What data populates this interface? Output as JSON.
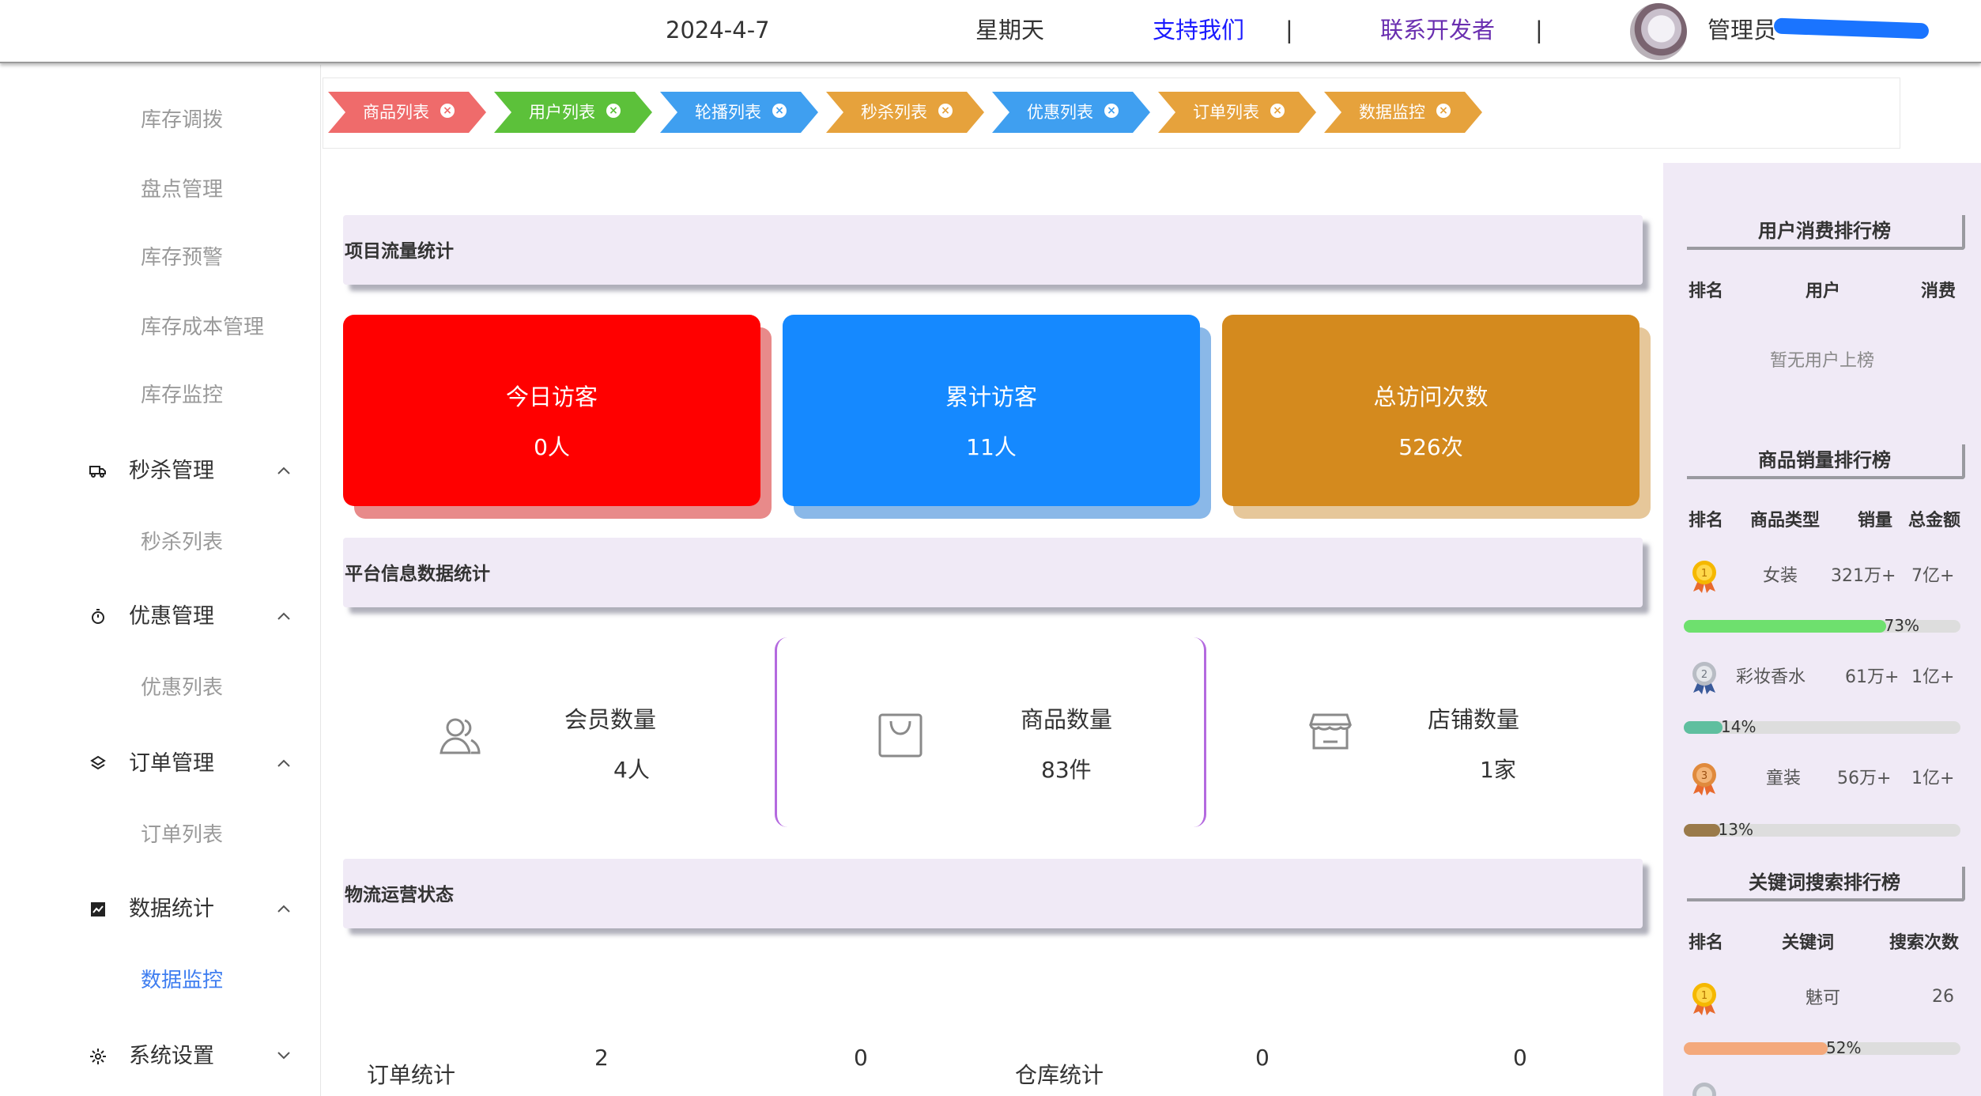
{
  "header": {
    "date": "2024-4-7",
    "weekday": "星期天",
    "support_link": "支持我们",
    "separator": "|",
    "contact_link": "联系开发者",
    "admin_label": "管理员"
  },
  "sidebar": {
    "top_items": [
      {
        "label": "库存调拨"
      },
      {
        "label": "盘点管理"
      },
      {
        "label": "库存预警"
      },
      {
        "label": "库存成本管理"
      },
      {
        "label": "库存监控"
      }
    ],
    "groups": [
      {
        "label": "秒杀管理",
        "icon": "truck-icon",
        "expanded": true,
        "children": [
          {
            "label": "秒杀列表"
          }
        ]
      },
      {
        "label": "优惠管理",
        "icon": "stopwatch-icon",
        "expanded": true,
        "children": [
          {
            "label": "优惠列表"
          }
        ]
      },
      {
        "label": "订单管理",
        "icon": "layers-icon",
        "expanded": true,
        "children": [
          {
            "label": "订单列表"
          }
        ]
      },
      {
        "label": "数据统计",
        "icon": "chart-icon",
        "expanded": true,
        "children": [
          {
            "label": "数据监控",
            "active": true
          }
        ]
      },
      {
        "label": "系统设置",
        "icon": "gear-icon",
        "expanded": false,
        "children": []
      }
    ]
  },
  "tabs": [
    {
      "label": "商品列表",
      "color": "#ef6b6b"
    },
    {
      "label": "用户列表",
      "color": "#5cc13a"
    },
    {
      "label": "轮播列表",
      "color": "#3f9ff0"
    },
    {
      "label": "秒杀列表",
      "color": "#e6a23c"
    },
    {
      "label": "优惠列表",
      "color": "#3f9ff0"
    },
    {
      "label": "订单列表",
      "color": "#e6a23c"
    },
    {
      "label": "数据监控",
      "color": "#e6a23c"
    }
  ],
  "sections": {
    "traffic": "项目流量统计",
    "platform": "平台信息数据统计",
    "logistics": "物流运营状态"
  },
  "traffic_cards": [
    {
      "label": "今日访客",
      "value": "0人",
      "color": "#ff0000",
      "shadow": "#e88a8a"
    },
    {
      "label": "累计访客",
      "value": "11人",
      "color": "#1589ff",
      "shadow": "#8ab8e8"
    },
    {
      "label": "总访问次数",
      "value": "526次",
      "color": "#d48a1e",
      "shadow": "#e6c79a"
    }
  ],
  "platform_stats": [
    {
      "label": "会员数量",
      "value": "4人",
      "icon": "users-icon"
    },
    {
      "label": "商品数量",
      "value": "83件",
      "icon": "shopping-bag-icon"
    },
    {
      "label": "店铺数量",
      "value": "1家",
      "icon": "store-icon"
    }
  ],
  "logistics": {
    "order_label": "订单统计",
    "order_values": [
      "2",
      "0"
    ],
    "warehouse_label": "仓库统计",
    "warehouse_values": [
      "0",
      "0"
    ]
  },
  "user_ranking": {
    "title": "用户消费排行榜",
    "headers": [
      "排名",
      "用户",
      "消费"
    ],
    "empty_text": "暂无用户上榜"
  },
  "sales_ranking": {
    "title": "商品销量排行榜",
    "headers": [
      "排名",
      "商品类型",
      "销量",
      "总金额"
    ],
    "rows": [
      {
        "type": "女装",
        "sales": "321万+",
        "amount": "7亿+",
        "percent": 73,
        "percent_label": "73%",
        "color": "#6ee06e",
        "medal": "gold"
      },
      {
        "type": "彩妆香水",
        "sales": "61万+",
        "amount": "1亿+",
        "percent": 14,
        "percent_label": "14%",
        "color": "#5fbf9f",
        "medal": "silver"
      },
      {
        "type": "童装",
        "sales": "56万+",
        "amount": "1亿+",
        "percent": 13,
        "percent_label": "13%",
        "color": "#9a7a4a",
        "medal": "bronze"
      }
    ]
  },
  "keyword_ranking": {
    "title": "关键词搜索排行榜",
    "headers": [
      "排名",
      "关键词",
      "搜索次数"
    ],
    "rows": [
      {
        "keyword": "魅可",
        "count": "26",
        "percent": 52,
        "percent_label": "52%",
        "color": "#f4a97c",
        "medal": "gold"
      }
    ]
  }
}
